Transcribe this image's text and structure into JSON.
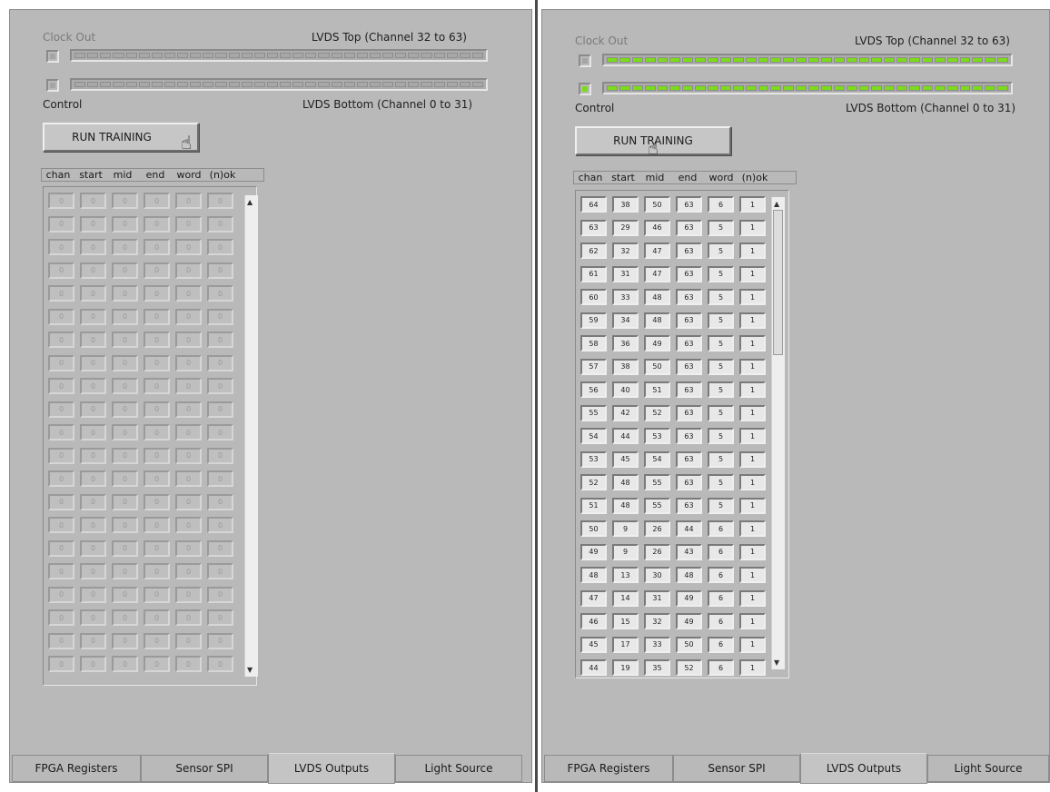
{
  "labels": {
    "clock_out": "Clock Out",
    "lvds_top": "LVDS Top (Channel 32 to 63)",
    "control": "Control",
    "lvds_bottom": "LVDS Bottom (Channel 0 to 31)",
    "run_training": "RUN TRAINING"
  },
  "columns": [
    "chan",
    "start",
    "mid",
    "end",
    "word",
    "(n)ok"
  ],
  "tabs": [
    "FPGA Registers",
    "Sensor SPI",
    "LVDS Outputs",
    "Light Source"
  ],
  "active_tab": "LVDS Outputs",
  "colors": {
    "panel": "#b9b9b9",
    "led_off": "#a8a8a8",
    "led_on": "#7cdc1a"
  },
  "left_panel": {
    "led_state": "off",
    "rows": [
      [
        "0",
        "0",
        "0",
        "0",
        "0",
        "0"
      ],
      [
        "0",
        "0",
        "0",
        "0",
        "0",
        "0"
      ],
      [
        "0",
        "0",
        "0",
        "0",
        "0",
        "0"
      ],
      [
        "0",
        "0",
        "0",
        "0",
        "0",
        "0"
      ],
      [
        "0",
        "0",
        "0",
        "0",
        "0",
        "0"
      ],
      [
        "0",
        "0",
        "0",
        "0",
        "0",
        "0"
      ],
      [
        "0",
        "0",
        "0",
        "0",
        "0",
        "0"
      ],
      [
        "0",
        "0",
        "0",
        "0",
        "0",
        "0"
      ],
      [
        "0",
        "0",
        "0",
        "0",
        "0",
        "0"
      ],
      [
        "0",
        "0",
        "0",
        "0",
        "0",
        "0"
      ],
      [
        "0",
        "0",
        "0",
        "0",
        "0",
        "0"
      ],
      [
        "0",
        "0",
        "0",
        "0",
        "0",
        "0"
      ],
      [
        "0",
        "0",
        "0",
        "0",
        "0",
        "0"
      ],
      [
        "0",
        "0",
        "0",
        "0",
        "0",
        "0"
      ],
      [
        "0",
        "0",
        "0",
        "0",
        "0",
        "0"
      ],
      [
        "0",
        "0",
        "0",
        "0",
        "0",
        "0"
      ],
      [
        "0",
        "0",
        "0",
        "0",
        "0",
        "0"
      ],
      [
        "0",
        "0",
        "0",
        "0",
        "0",
        "0"
      ],
      [
        "0",
        "0",
        "0",
        "0",
        "0",
        "0"
      ],
      [
        "0",
        "0",
        "0",
        "0",
        "0",
        "0"
      ],
      [
        "0",
        "0",
        "0",
        "0",
        "0",
        "0"
      ]
    ]
  },
  "right_panel": {
    "led_state": "on",
    "rows": [
      [
        "64",
        "38",
        "50",
        "63",
        "6",
        "1"
      ],
      [
        "63",
        "29",
        "46",
        "63",
        "5",
        "1"
      ],
      [
        "62",
        "32",
        "47",
        "63",
        "5",
        "1"
      ],
      [
        "61",
        "31",
        "47",
        "63",
        "5",
        "1"
      ],
      [
        "60",
        "33",
        "48",
        "63",
        "5",
        "1"
      ],
      [
        "59",
        "34",
        "48",
        "63",
        "5",
        "1"
      ],
      [
        "58",
        "36",
        "49",
        "63",
        "5",
        "1"
      ],
      [
        "57",
        "38",
        "50",
        "63",
        "5",
        "1"
      ],
      [
        "56",
        "40",
        "51",
        "63",
        "5",
        "1"
      ],
      [
        "55",
        "42",
        "52",
        "63",
        "5",
        "1"
      ],
      [
        "54",
        "44",
        "53",
        "63",
        "5",
        "1"
      ],
      [
        "53",
        "45",
        "54",
        "63",
        "5",
        "1"
      ],
      [
        "52",
        "48",
        "55",
        "63",
        "5",
        "1"
      ],
      [
        "51",
        "48",
        "55",
        "63",
        "5",
        "1"
      ],
      [
        "50",
        "9",
        "26",
        "44",
        "6",
        "1"
      ],
      [
        "49",
        "9",
        "26",
        "43",
        "6",
        "1"
      ],
      [
        "48",
        "13",
        "30",
        "48",
        "6",
        "1"
      ],
      [
        "47",
        "14",
        "31",
        "49",
        "6",
        "1"
      ],
      [
        "46",
        "15",
        "32",
        "49",
        "6",
        "1"
      ],
      [
        "45",
        "17",
        "33",
        "50",
        "6",
        "1"
      ],
      [
        "44",
        "19",
        "35",
        "52",
        "6",
        "1"
      ]
    ]
  }
}
